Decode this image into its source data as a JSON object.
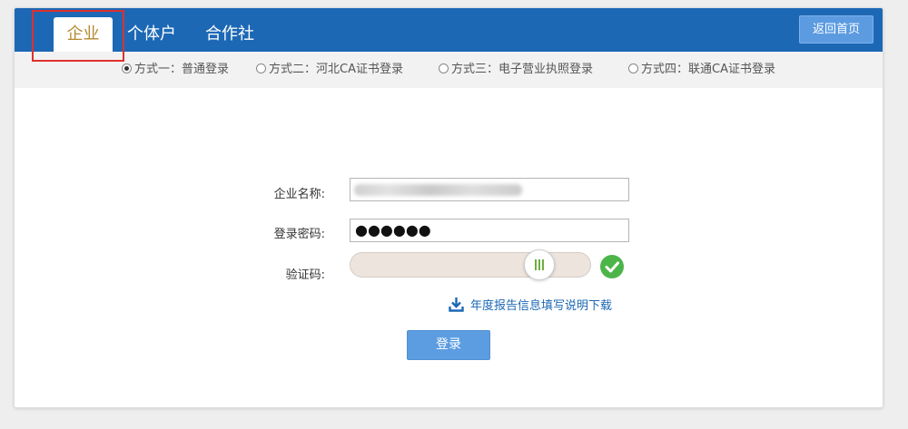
{
  "tabs": [
    {
      "label": "企业",
      "active": true
    },
    {
      "label": "个体户",
      "active": false
    },
    {
      "label": "合作社",
      "active": false
    }
  ],
  "home_button": "返回首页",
  "login_options": [
    {
      "label": "方式一：普通登录",
      "selected": true
    },
    {
      "label": "方式二：河北CA证书登录",
      "selected": false
    },
    {
      "label": "方式三：电子营业执照登录",
      "selected": false
    },
    {
      "label": "方式四：联通CA证书登录",
      "selected": false
    }
  ],
  "form": {
    "company_name_label": "企业名称:",
    "company_name_value": "",
    "password_label": "登录密码:",
    "password_value": "●●●●●●",
    "captcha_label": "验证码:",
    "captcha_slider_progress": 0.78,
    "captcha_verified": true
  },
  "download_link": "年度报告信息填写说明下载",
  "login_button": "登录",
  "colors": {
    "header_blue": "#1c68b5",
    "active_tab_text": "#b58a2f",
    "button_blue": "#5b9de0",
    "success_green": "#4cb54a",
    "highlight_red": "#e0302c"
  }
}
